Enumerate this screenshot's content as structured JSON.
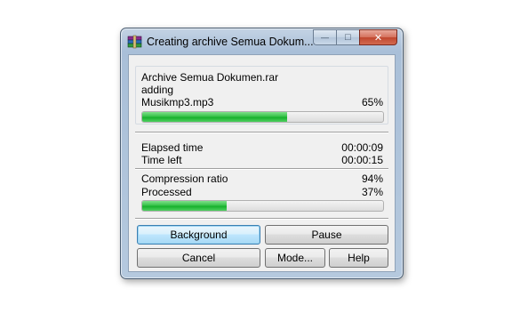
{
  "window": {
    "title": "Creating archive Semua Dokum...",
    "min_symbol": "—",
    "max_symbol": "□",
    "close_symbol": "✕"
  },
  "progress_file": {
    "archive_name": "Archive Semua Dokumen.rar",
    "action": "adding",
    "current_file": "Musikmp3.mp3",
    "percent_label": "65%",
    "fraction": 0.6
  },
  "times": {
    "elapsed_label": "Elapsed time",
    "elapsed_value": "00:00:09",
    "left_label": "Time left",
    "left_value": "00:00:15"
  },
  "stats": {
    "ratio_label": "Compression ratio",
    "ratio_value": "94%",
    "processed_label": "Processed",
    "processed_value": "37%",
    "fraction": 0.35
  },
  "buttons": {
    "background": "Background",
    "pause": "Pause",
    "cancel": "Cancel",
    "mode": "Mode...",
    "help": "Help"
  },
  "colors": {
    "progress_green": "#16b02c",
    "default_button_border": "#3c7fb1"
  },
  "icons": {
    "app": "winrar-books-icon"
  }
}
